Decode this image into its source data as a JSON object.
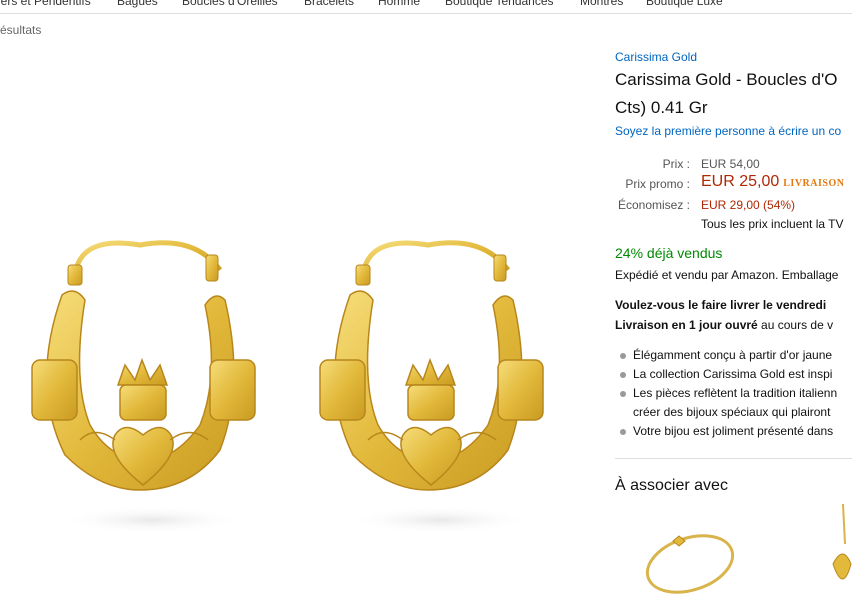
{
  "nav": {
    "items": [
      "iers et Pendentifs",
      "Bagues",
      "Boucles d'Oreilles",
      "Bracelets",
      "Homme",
      "Boutique Tendances",
      "Montres",
      "Boutique Luxe"
    ]
  },
  "results_text": "ésultats",
  "product": {
    "brand": "Carissima Gold",
    "title_line1": "Carissima Gold - Boucles d'O",
    "title_line2": "Cts) 0.41 Gr",
    "review_link": "Soyez la première personne à écrire un co",
    "price_label": "Prix :",
    "price_value": "EUR 54,00",
    "promo_label": "Prix promo :",
    "promo_value": "EUR 25,00",
    "livraison": "LIVRAISON",
    "save_label": "Économisez :",
    "save_value": "EUR 29,00 (54%)",
    "tax_note": "Tous les prix incluent la TV",
    "sold": "24% déjà vendus",
    "shipped": "Expédié et vendu par Amazon. Emballage",
    "deliver_line1": "Voulez-vous le faire livrer le vendredi",
    "deliver_line2_bold": "Livraison en 1 jour ouvré",
    "deliver_line2_rest": " au cours de v",
    "bullets": [
      "Élégamment conçu à partir d'or jaune",
      "La collection Carissima Gold est inspi",
      "Les pièces reflètent la tradition italienn",
      "créer des bijoux spéciaux qui plairont",
      "Votre bijou est joliment présenté dans"
    ],
    "associate_heading": "À associer avec"
  },
  "colors": {
    "link": "#0066c0",
    "promo_price": "#b12704",
    "sold_green": "#008a00",
    "gold": "#e8c14a"
  }
}
